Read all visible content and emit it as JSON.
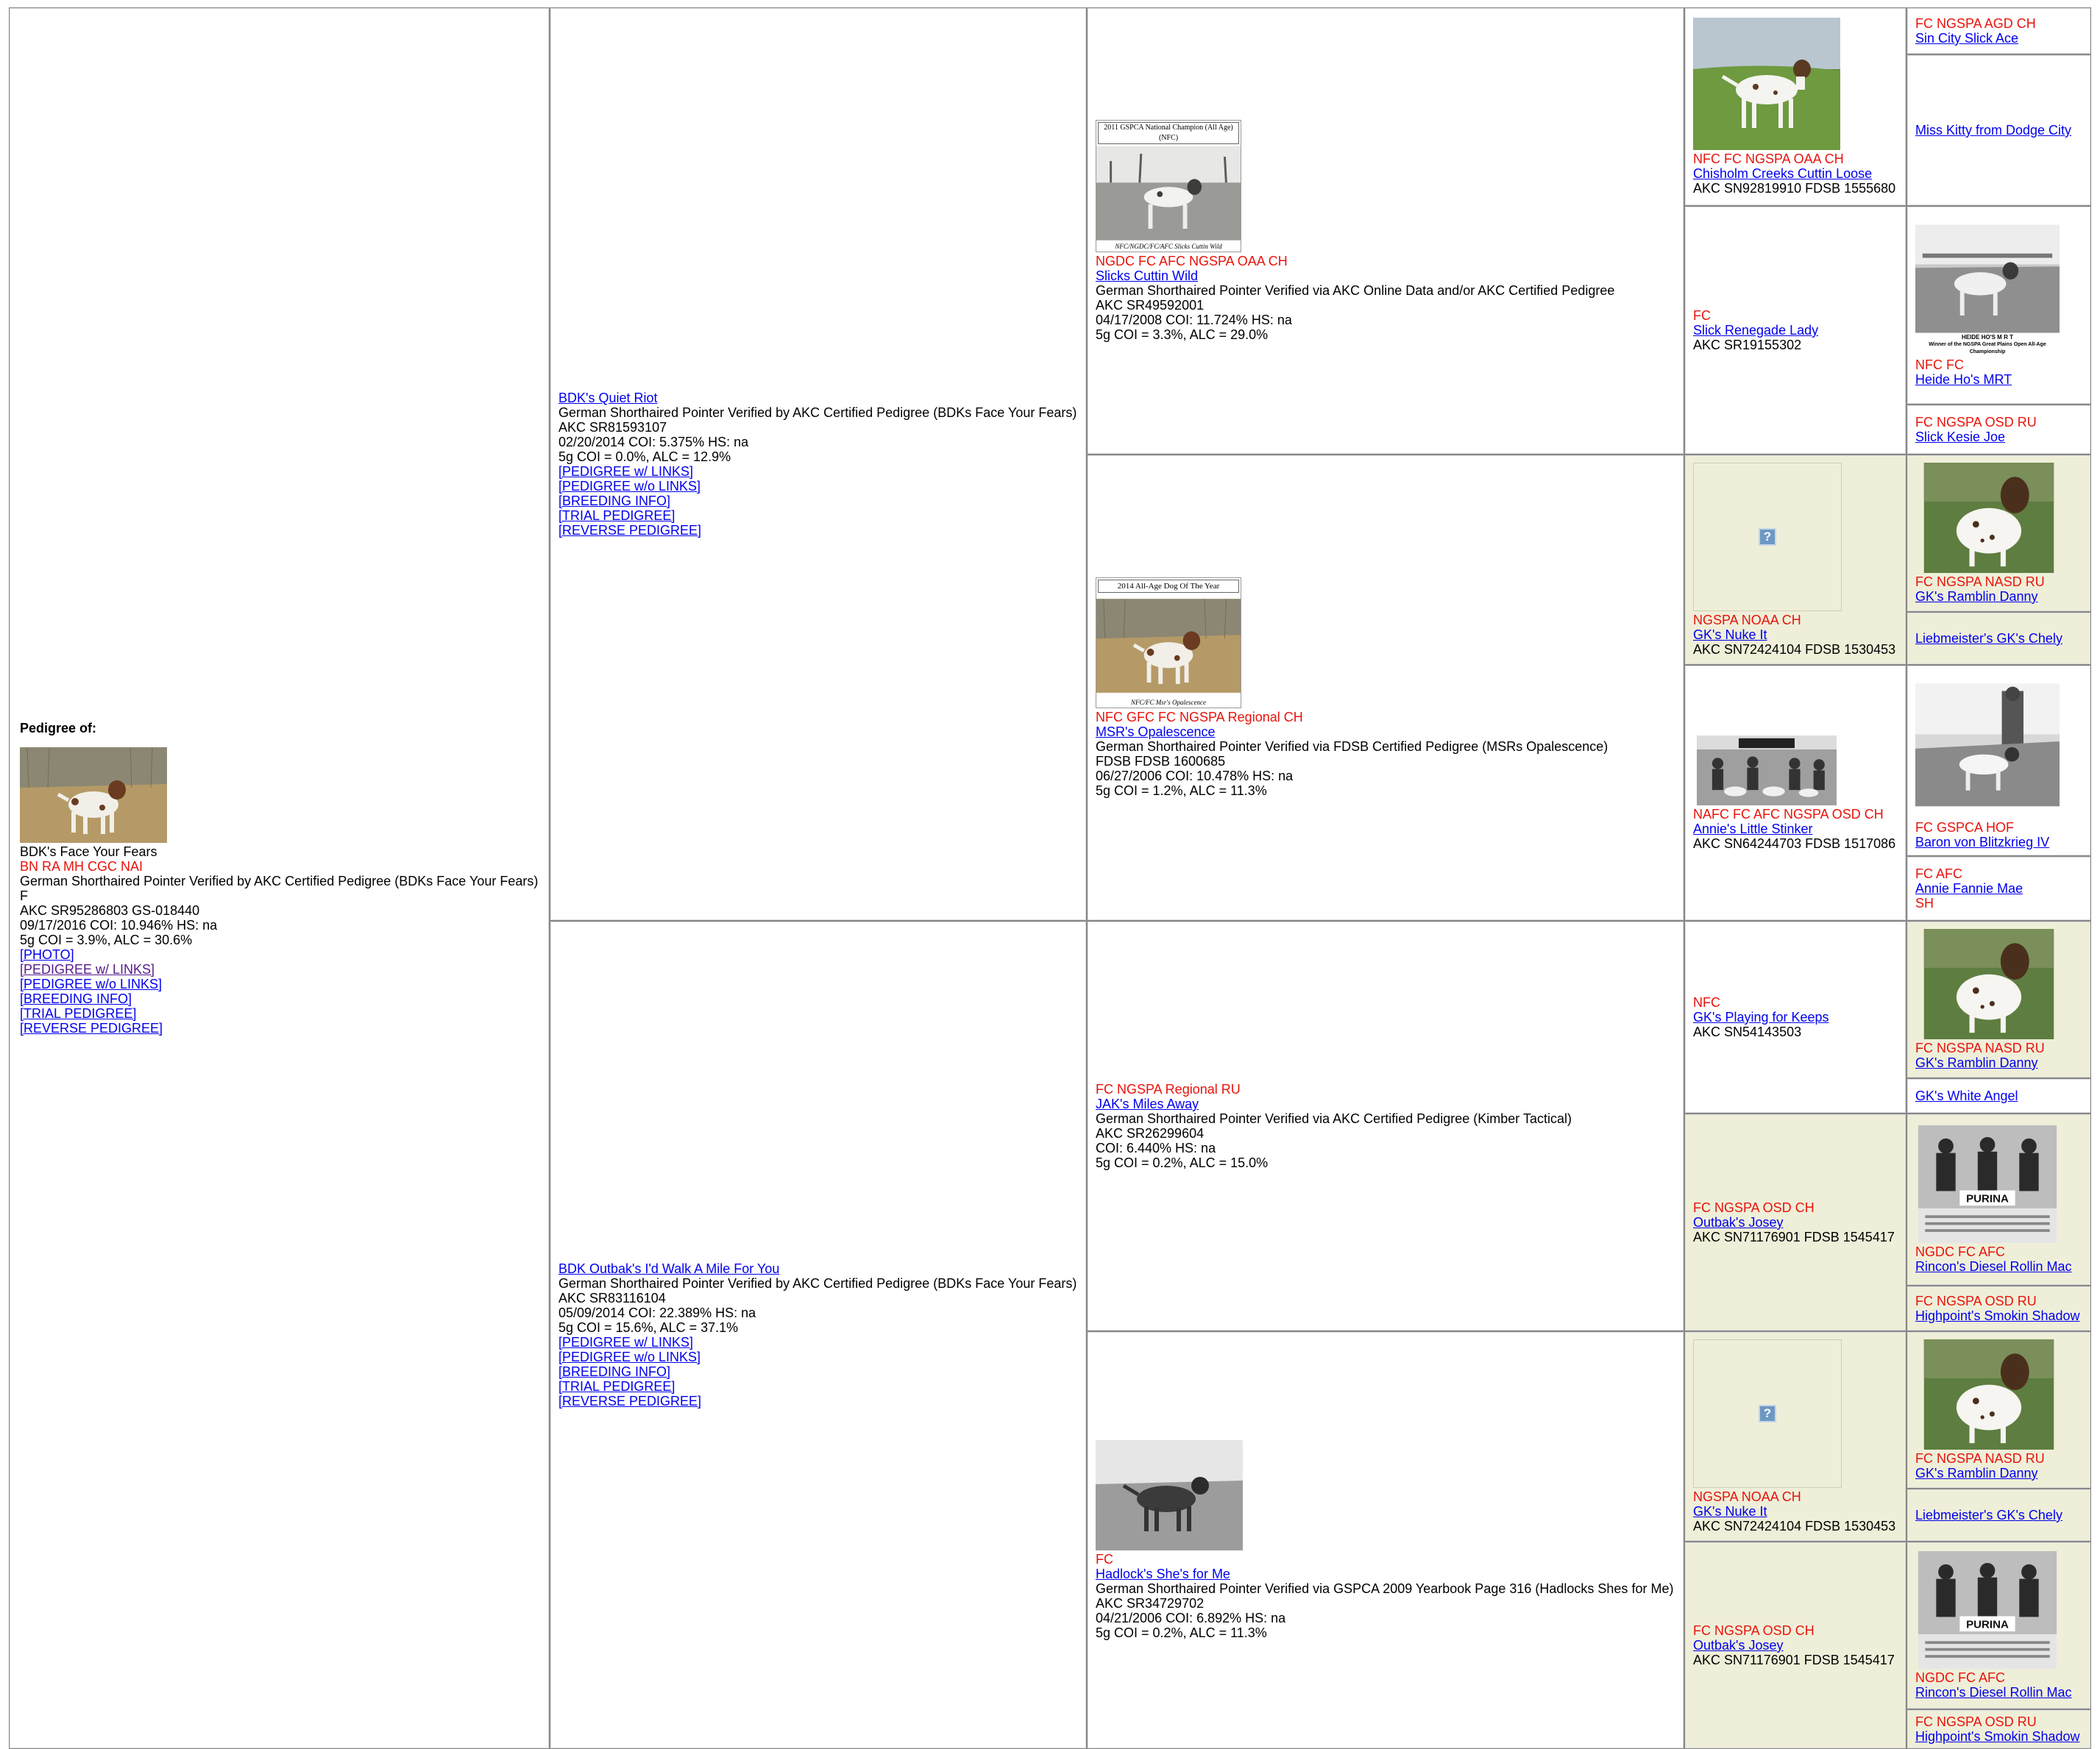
{
  "subject": {
    "heading": "Pedigree of:",
    "name": "BDK's Face Your Fears",
    "titles": "BN RA MH CGC NAI",
    "verified": "German Shorthaired Pointer Verified by AKC Certified Pedigree (BDKs Face Your Fears)",
    "sex": "F",
    "reg": "AKC SR95286803 GS-018440",
    "coi": "09/17/2016 COI: 10.946% HS: na",
    "coi5": "5g COI = 3.9%, ALC = 30.6%",
    "links": [
      "[PHOTO]",
      "[PEDIGREE w/ LINKS]",
      "[PEDIGREE w/o LINKS]",
      "[BREEDING INFO]",
      "[TRIAL PEDIGREE]",
      "[REVERSE PEDIGREE]"
    ]
  },
  "sire": {
    "name": "BDK's Quiet Riot",
    "verified": "German Shorthaired Pointer Verified by AKC Certified Pedigree (BDKs Face Your Fears)",
    "reg": "AKC SR81593107",
    "coi": "02/20/2014 COI: 5.375% HS: na",
    "coi5": "5g COI = 0.0%, ALC = 12.9%",
    "links": [
      "[PEDIGREE w/ LINKS]",
      "[PEDIGREE w/o LINKS]",
      "[BREEDING INFO]",
      "[TRIAL PEDIGREE]",
      "[REVERSE PEDIGREE]"
    ]
  },
  "dam": {
    "name": "BDK Outbak's I'd Walk A Mile For You",
    "verified": "German Shorthaired Pointer Verified by AKC Certified Pedigree (BDKs Face Your Fears)",
    "reg": "AKC SR83116104",
    "coi": "05/09/2014 COI: 22.389% HS: na",
    "coi5": "5g COI = 15.6%, ALC = 37.1%",
    "links": [
      "[PEDIGREE w/ LINKS]",
      "[PEDIGREE w/o LINKS]",
      "[BREEDING INFO]",
      "[TRIAL PEDIGREE]",
      "[REVERSE PEDIGREE]"
    ]
  },
  "gen3": [
    {
      "titles": "NGDC FC AFC NGSPA OAA CH",
      "name": "Slicks Cuttin Wild",
      "verified": "German Shorthaired Pointer Verified via AKC Online Data and/or AKC Certified Pedigree",
      "reg": "AKC SR49592001",
      "coi": "04/17/2008 COI: 11.724% HS: na",
      "coi5": "5g COI = 3.3%, ALC = 29.0%",
      "photo_caption": "2011 GSPCA National Champion (All Age)(NFC)",
      "photo_sub": "NFC/NGDC/FC/AFC Slicks Cuttin Wild"
    },
    {
      "titles": "NFC GFC FC NGSPA Regional CH",
      "name": "MSR's Opalescence",
      "verified": "German Shorthaired Pointer Verified via FDSB Certified Pedigree (MSRs Opalescence)",
      "reg": "FDSB FDSB 1600685",
      "coi": "06/27/2006 COI: 10.478% HS: na",
      "coi5": "5g COI = 1.2%, ALC = 11.3%",
      "photo_caption": "2014 All-Age Dog Of The Year",
      "photo_sub": "NFC/FC Msr's Opalescence"
    },
    {
      "titles": "FC NGSPA Regional RU",
      "name": "JAK's Miles Away",
      "verified": "German Shorthaired Pointer Verified via AKC Certified Pedigree (Kimber Tactical)",
      "reg": "AKC SR26299604",
      "coi": "COI: 6.440% HS: na",
      "coi5": "5g COI = 0.2%, ALC = 15.0%"
    },
    {
      "titles": "FC",
      "name": "Hadlock's She's for Me",
      "verified": "German Shorthaired Pointer Verified via GSPCA 2009 Yearbook Page 316 (Hadlocks Shes for Me)",
      "reg": "AKC SR34729702",
      "coi": "04/21/2006 COI: 6.892% HS: na",
      "coi5": "5g COI = 0.2%, ALC = 11.3%"
    }
  ],
  "gen4": [
    {
      "titles": "NFC FC NGSPA OAA CH",
      "name": "Chisholm Creeks Cuttin Loose",
      "reg": "AKC SN92819910 FDSB 1555680"
    },
    {
      "titles": "FC",
      "name": "Slick Renegade Lady",
      "reg": "AKC SR19155302"
    },
    {
      "titles": "NGSPA NOAA CH",
      "name": "GK's Nuke It",
      "reg": "AKC SN72424104 FDSB 1530453"
    },
    {
      "titles": "NAFC FC AFC NGSPA OSD CH",
      "name": "Annie's Little Stinker",
      "reg": "AKC SN64244703 FDSB 1517086"
    },
    {
      "titles": "NFC",
      "name": "GK's Playing for Keeps",
      "reg": "AKC SN54143503"
    },
    {
      "titles": "FC NGSPA OSD CH",
      "name": "Outbak's Josey",
      "reg": "AKC SN71176901 FDSB 1545417"
    },
    {
      "titles": "NGSPA NOAA CH",
      "name": "GK's Nuke It",
      "reg": "AKC SN72424104 FDSB 1530453"
    },
    {
      "titles": "FC NGSPA OSD CH",
      "name": "Outbak's Josey",
      "reg": "AKC SN71176901 FDSB 1545417"
    }
  ],
  "gen5": [
    {
      "titles": "FC NGSPA AGD CH",
      "name": "Sin City Slick Ace"
    },
    {
      "titles": "",
      "name": "Miss Kitty from Dodge City"
    },
    {
      "titles": "NFC FC",
      "name": "Heide Ho's MRT",
      "photo_caption": "HEIDE HO'S M R T",
      "photo_sub": "Winner of the NGSPA Great Plains Open All-Age Championship"
    },
    {
      "titles": "FC NGSPA OSD RU",
      "name": "Slick Kesie Joe"
    },
    {
      "titles": "FC NGSPA NASD RU",
      "name": "GK's Ramblin Danny"
    },
    {
      "titles": "",
      "name": "Liebmeister's GK's Chely"
    },
    {
      "titles": "FC GSPCA HOF",
      "name": "Baron von Blitzkrieg IV"
    },
    {
      "titles": "FC AFC",
      "name": "Annie Fannie Mae",
      "suffix": "SH"
    },
    {
      "titles": "FC NGSPA NASD RU",
      "name": "GK's Ramblin Danny"
    },
    {
      "titles": "",
      "name": "GK's White Angel"
    },
    {
      "titles": "NGDC FC AFC",
      "name": "Rincon's Diesel Rollin Mac",
      "photo_caption": "PURINA"
    },
    {
      "titles": "FC NGSPA OSD RU",
      "name": "Highpoint's Smokin Shadow"
    },
    {
      "titles": "FC NGSPA NASD RU",
      "name": "GK's Ramblin Danny"
    },
    {
      "titles": "",
      "name": "Liebmeister's GK's Chely"
    },
    {
      "titles": "NGDC FC AFC",
      "name": "Rincon's Diesel Rollin Mac",
      "photo_caption": "PURINA"
    },
    {
      "titles": "FC NGSPA OSD RU",
      "name": "Highpoint's Smokin Shadow"
    }
  ],
  "icons": {
    "missing_photo": "question-mark-icon"
  },
  "colors": {
    "title_red": "#e8130b",
    "link_blue": "#0000ee",
    "visited": "#551a8b",
    "tint": "#efefd9"
  }
}
